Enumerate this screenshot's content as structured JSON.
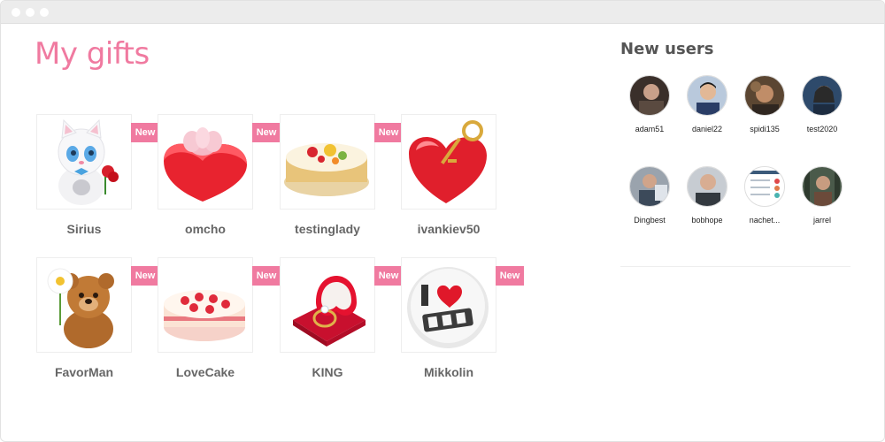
{
  "page": {
    "title": "My gifts"
  },
  "gifts": [
    {
      "name": "Sirius",
      "badge": "New",
      "icon": "kitten-with-rose-icon"
    },
    {
      "name": "omcho",
      "badge": "New",
      "icon": "heart-gift-box-icon"
    },
    {
      "name": "testinglady",
      "badge": "New",
      "icon": "fruit-cake-icon"
    },
    {
      "name": "ivankiev50",
      "badge": "New",
      "icon": "heart-lock-with-key-icon"
    },
    {
      "name": "FavorMan",
      "badge": "New",
      "icon": "teddy-bear-with-daisy-icon"
    },
    {
      "name": "LoveCake",
      "badge": "New",
      "icon": "strawberry-cake-icon"
    },
    {
      "name": "KING",
      "badge": "New",
      "icon": "ring-box-icon"
    },
    {
      "name": "Mikkolin",
      "badge": "New",
      "icon": "i-love-you-badge-icon"
    }
  ],
  "sidebar": {
    "title": "New users",
    "users": [
      {
        "name": "adam51"
      },
      {
        "name": "daniel22"
      },
      {
        "name": "spidi135"
      },
      {
        "name": "test2020"
      },
      {
        "name": "Dingbest"
      },
      {
        "name": "bobhope"
      },
      {
        "name": "nachet..."
      },
      {
        "name": "jarrel"
      }
    ]
  },
  "colors": {
    "accent": "#f07aa0",
    "text_muted": "#666666"
  }
}
